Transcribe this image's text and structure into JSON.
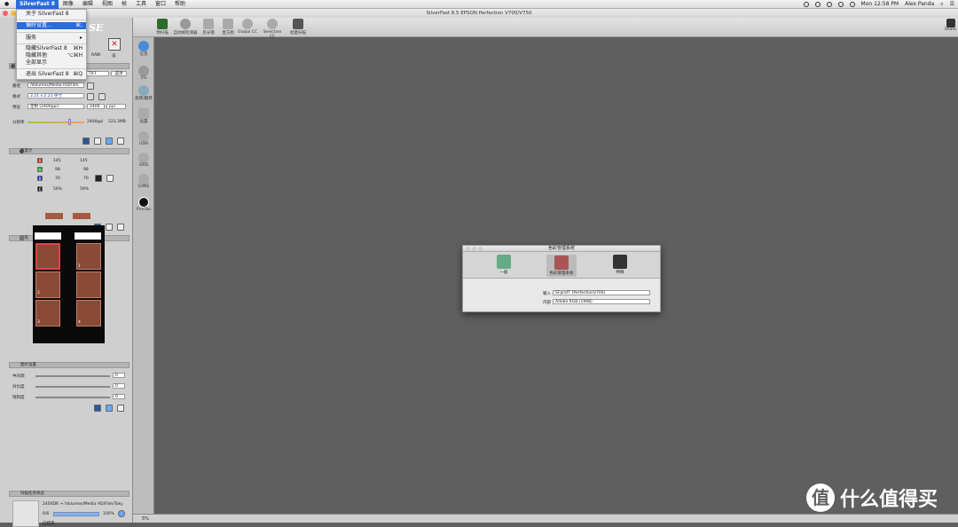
{
  "menubar": {
    "app": "SilverFast 8",
    "items": [
      "图像",
      "编辑",
      "视图",
      "帧",
      "工具",
      "窗口",
      "帮助"
    ],
    "time": "Mon 12:58 PM",
    "user": "Alex Panda"
  },
  "window": {
    "title": "SilverFast 8.5 EPSON Perfection V700/V750"
  },
  "app_menu": {
    "about": "关于 SilverFast 8",
    "prefs": "偏好设置...",
    "prefs_sc": "⌘,",
    "services": "服务",
    "hide": "隐藏SilverFast 8",
    "hide_sc": "⌘H",
    "hide_others": "隐藏其他",
    "hide_others_sc": "⌥⌘H",
    "show_all": "全部显示",
    "quit": "退出 SilverFast 8",
    "quit_sc": "⌘Q"
  },
  "toolbar": {
    "items": [
      "预扫描",
      "自动帧检测器",
      "反光镜",
      "直方图",
      "Global CC",
      "Selective CC",
      "批量扫描"
    ],
    "share": "Share"
  },
  "left": {
    "logo": "SE",
    "raw": "RAW",
    "tiff": "TIFF",
    "option": "选项",
    "path_label": "路径",
    "path": "/Volumes/Media HD/Film",
    "format_label": "格式",
    "format": "2.21 x 2.21 英寸",
    "preset_label": "预设",
    "preset": "定制 (2400ppi)",
    "ppi": "2400",
    "ppi_unit": "ppi",
    "res_label": "分辨率",
    "res_value": "2400ppi",
    "res_size": "223.3MB",
    "sec_density": "密度计",
    "dens": [
      {
        "c": "R",
        "a": "145",
        "b": "145"
      },
      {
        "c": "G",
        "a": "98",
        "b": "98"
      },
      {
        "c": "B",
        "a": "70",
        "b": "70"
      },
      {
        "c": "K",
        "a": "59%",
        "b": "59%"
      }
    ],
    "sec_nav": "导航",
    "frame_nums": [
      "1",
      "2",
      "3",
      "4"
    ],
    "sec_adjust": "图片设置",
    "midtone": "中间调",
    "contrast": "对比度",
    "saturation": "饱和度",
    "mid_v": "0",
    "con_v": "0",
    "sat_v": "0",
    "sec_status": "扫描任务状态",
    "job_path": "2400DR → /Volumes/Media HD/Film/Toky",
    "job_count": "6/6",
    "job_pct": "100%",
    "job_state": "已结束"
  },
  "tools": [
    "信息",
    "5%",
    "旋转/翻转",
    "设置",
    "USM",
    "iSRD",
    "GANE",
    "PrinTao"
  ],
  "status": "5%",
  "dialog": {
    "title": "色彩管理系统",
    "tabs": [
      "一般",
      "色彩管理系统",
      "特殊"
    ],
    "input_label": "输入",
    "input": "SFprofT (PerfectionV700)",
    "internal_label": "内部",
    "internal": "Adobe RGB (1998)"
  },
  "watermark": "什么值得买"
}
